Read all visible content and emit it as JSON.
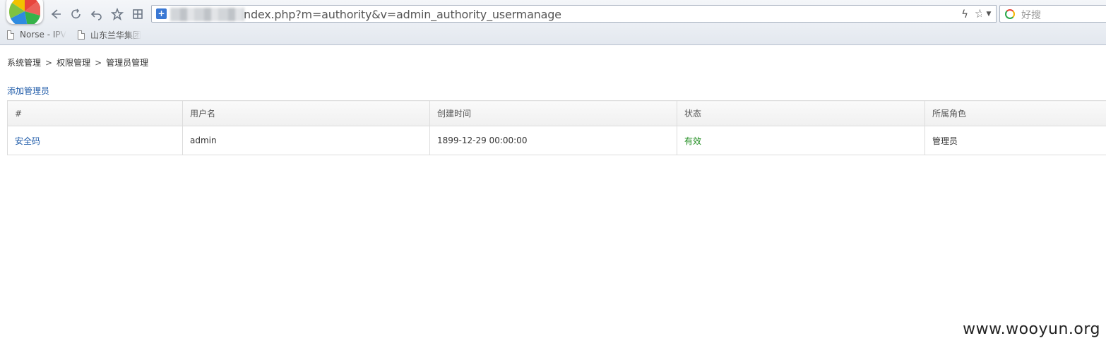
{
  "browser": {
    "address": {
      "url_visible": "ndex.php?m=authority&v=admin_authority_usermanage"
    },
    "search": {
      "placeholder": "好搜"
    },
    "bookmarks": [
      {
        "label": "Norse - IPV"
      },
      {
        "label": "山东兰华集团"
      }
    ]
  },
  "page": {
    "breadcrumb": [
      "系统管理",
      "权限管理",
      "管理员管理"
    ],
    "breadcrumb_separator": ">",
    "add_admin_label": "添加管理员",
    "table": {
      "columns": [
        "#",
        "用户名",
        "创建时间",
        "状态",
        "所属角色"
      ],
      "rows": [
        {
          "id": "安全码",
          "username": "admin",
          "created": "1899-12-29 00:00:00",
          "status": "有效",
          "role": "管理员"
        }
      ]
    }
  },
  "watermark": "www.wooyun.org",
  "colors": {
    "link": "#1e5aa8",
    "status_active": "#1a8a1a"
  }
}
